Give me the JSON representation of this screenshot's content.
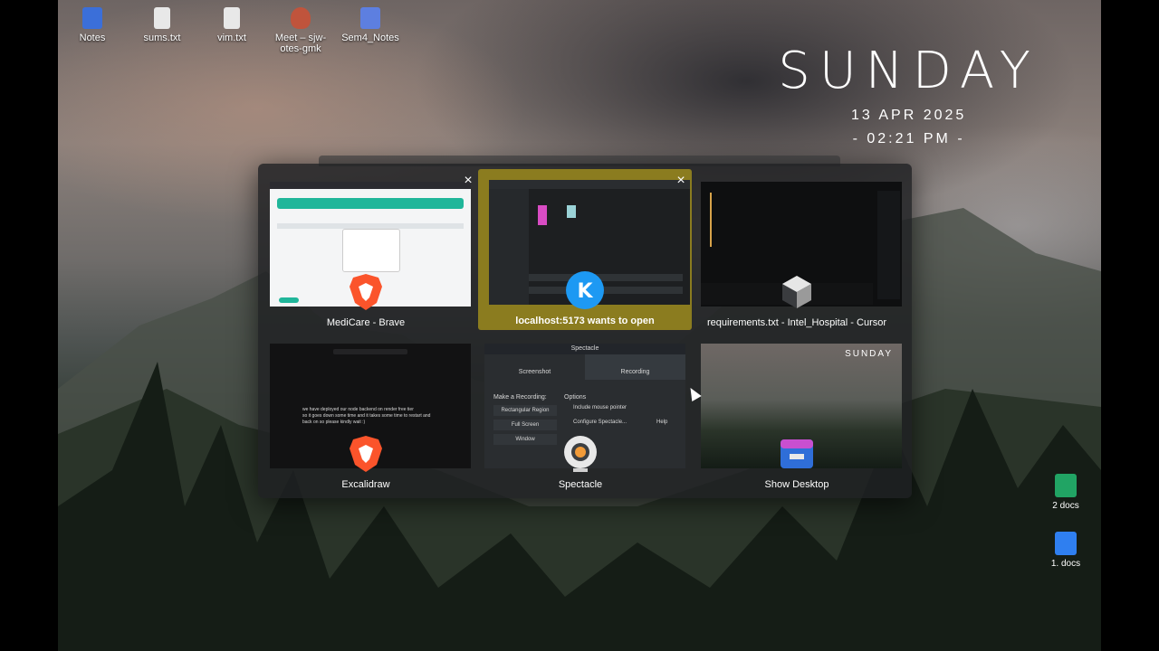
{
  "desktop_icons": [
    {
      "label": "Notes",
      "icon": "folder-icon",
      "color": "#3b6fd9"
    },
    {
      "label": "sums.txt",
      "icon": "text-file-icon",
      "color": "#e8e8e8"
    },
    {
      "label": "vim.txt",
      "icon": "text-file-icon",
      "color": "#e8e8e8"
    },
    {
      "label": "Meet – sjw-otes-gmk",
      "icon": "meet-shortcut-icon",
      "color": "#c0543c"
    },
    {
      "label": "Sem4_Notes",
      "icon": "notes-folder-icon",
      "color": "#5d7fe0"
    }
  ],
  "clock": {
    "day": "SUNDAY",
    "date": "13 APR 2025",
    "time": "- 02:21 PM -"
  },
  "windows": [
    {
      "label": "MediCare - Brave",
      "app_icon": "brave-icon",
      "active": false,
      "closable": true
    },
    {
      "label": "localhost:5173 wants to open",
      "app_icon": "kde-icon",
      "active": true,
      "closable": true
    },
    {
      "label": "requirements.txt - Intel_Hospital - Cursor",
      "app_icon": "cursor-icon",
      "active": false,
      "closable": false
    },
    {
      "label": "Excalidraw",
      "app_icon": "brave-icon",
      "active": false,
      "closable": false
    },
    {
      "label": "Spectacle",
      "app_icon": "spectacle-icon",
      "active": false,
      "closable": false
    },
    {
      "label": "Show Desktop",
      "app_icon": "show-desktop-icon",
      "active": false,
      "closable": false
    }
  ],
  "spectacle_thumb": {
    "title": "Spectacle",
    "tab_screenshot": "Screenshot",
    "tab_recording": "Recording",
    "make_recording": "Make a Recording:",
    "options": "Options",
    "btn_region": "Rectangular Region",
    "btn_full": "Full Screen",
    "btn_window": "Window",
    "chk_pointer": "Include mouse pointer",
    "btn_configure": "Configure Spectacle...",
    "btn_help": "Help"
  },
  "excalidraw_thumb": {
    "line1": "we have deployed our node backend on render free tier",
    "line2": "so it goes down some time and it takes some time to restart and",
    "line3": "back on so please kindly wait :)"
  },
  "side_icons": [
    {
      "label": "2 docs",
      "icon": "sheets-icon",
      "color": "#21a464"
    },
    {
      "label": "1. docs",
      "icon": "docs-icon",
      "color": "#2f7ff0"
    }
  ],
  "colors": {
    "active_tile": "#8b7c1f",
    "switcher_bg": "#1e2022"
  }
}
